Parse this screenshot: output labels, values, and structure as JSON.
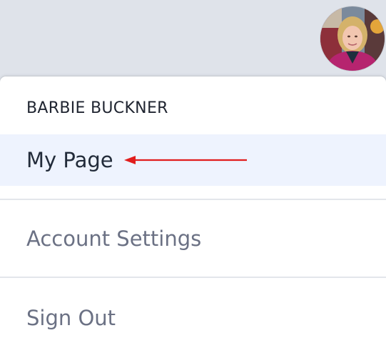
{
  "user": {
    "avatar_icon": "user-avatar-photo",
    "name": "BARBIE BUCKNER"
  },
  "menu": {
    "items": [
      {
        "label": "My Page",
        "highlighted": true
      },
      {
        "label": "Account Settings",
        "highlighted": false
      },
      {
        "label": "Sign Out",
        "highlighted": false
      }
    ]
  },
  "annotation": {
    "icon": "arrow-left-icon",
    "color": "#e11d1d"
  },
  "colors": {
    "page_bg": "#dfe3ea",
    "menu_bg": "#ffffff",
    "highlight_bg": "#eef3fe"
  }
}
